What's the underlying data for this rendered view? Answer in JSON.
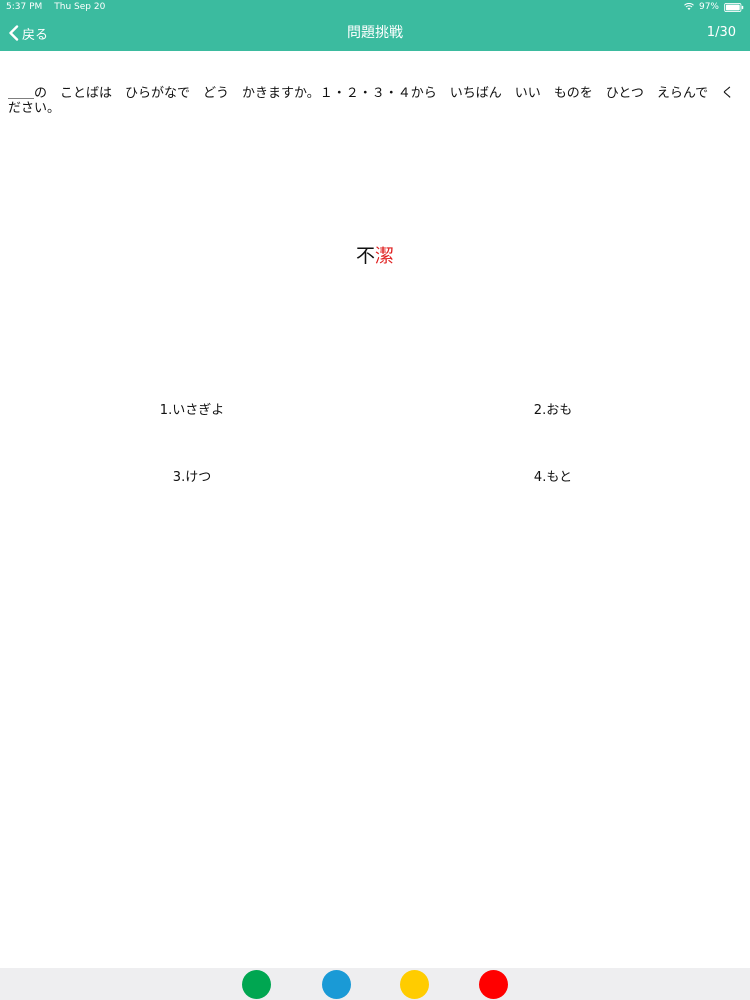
{
  "status_bar": {
    "time": "5:37 PM",
    "date": "Thu Sep 20",
    "battery": "97%",
    "icons": [
      "wifi-icon",
      "battery-icon"
    ]
  },
  "nav": {
    "back_label": "戻る",
    "back_icon": "chevron-left-icon",
    "title": "問題挑戦",
    "counter": "1/30"
  },
  "question": {
    "instruction": "＿＿の　ことばは　ひらがなで　どう　かきますか。１・２・３・４から　いちばん　いい　ものを　ひとつ　えらんで　ください。",
    "word_prefix": "不",
    "word_highlight": "潔"
  },
  "options": [
    {
      "label": "1.いさぎよ"
    },
    {
      "label": "2.おも"
    },
    {
      "label": "3.けつ"
    },
    {
      "label": "4.もと"
    }
  ],
  "colors": {
    "header": "#3bbb9f",
    "highlight": "#e02020",
    "dots": [
      "#00a651",
      "#1a9ad6",
      "#ffcc00",
      "#ff0000"
    ]
  }
}
